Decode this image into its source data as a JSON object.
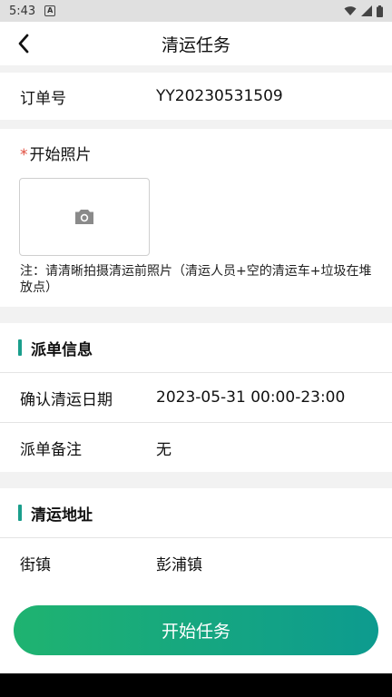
{
  "status_bar": {
    "time": "5:43",
    "notif_icon_letter": "A"
  },
  "header": {
    "title": "清运任务"
  },
  "order": {
    "label": "订单号",
    "value": "YY20230531509"
  },
  "photo": {
    "required_mark": "*",
    "title": "开始照片",
    "note": "注：请清晰拍摄清运前照片（清运人员+空的清运车+垃圾在堆放点）"
  },
  "dispatch": {
    "heading": "派单信息",
    "rows": [
      {
        "label": "确认清运日期",
        "value": "2023-05-31 00:00-23:00"
      },
      {
        "label": "派单备注",
        "value": "无"
      }
    ]
  },
  "address": {
    "heading": "清运地址",
    "rows": [
      {
        "label": "街镇",
        "value": "彭浦镇"
      }
    ]
  },
  "actions": {
    "start_label": "开始任务"
  },
  "colors": {
    "accent": "#1a9e8c",
    "button_start": "#1fb370",
    "button_end": "#0d9b8f",
    "required": "#e04b3c"
  }
}
